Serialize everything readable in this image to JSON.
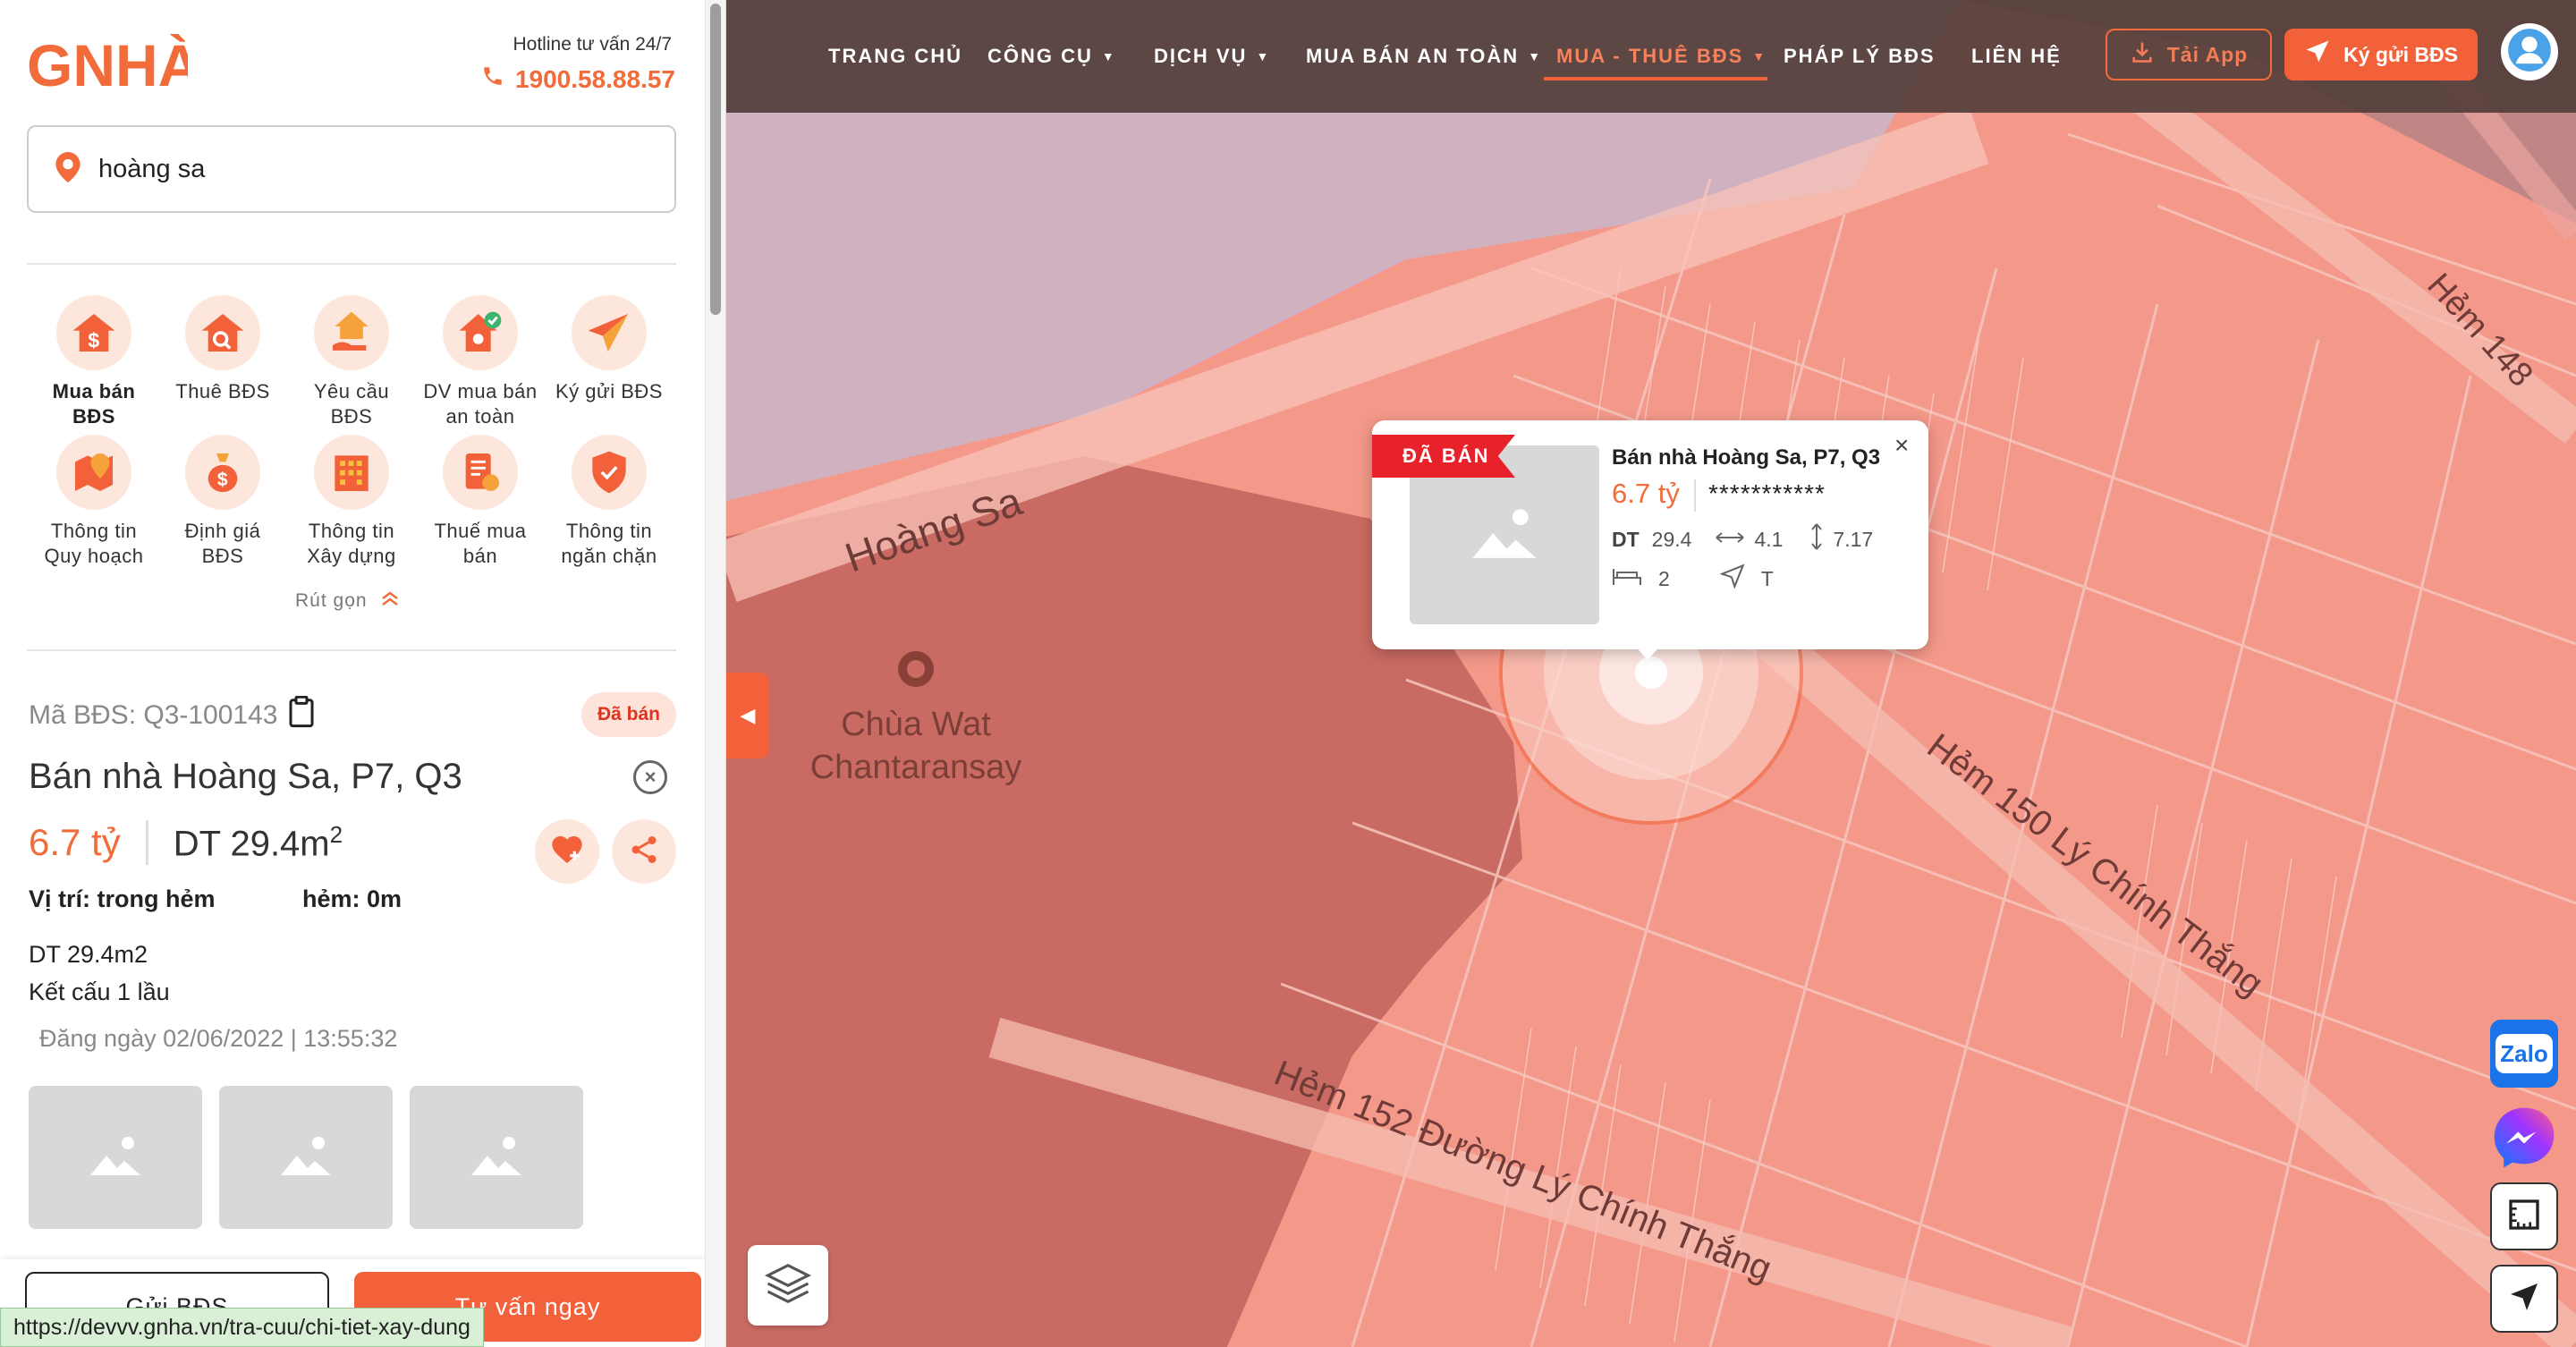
{
  "brand": {
    "logo_text": "GNHÀ"
  },
  "hotline": {
    "label": "Hotline tư vấn 24/7",
    "number": "1900.58.88.57"
  },
  "search": {
    "value": "hoàng sa"
  },
  "categories": [
    {
      "label": "Mua bán\nBĐS",
      "icon": "house-dollar-icon"
    },
    {
      "label": "Thuê BĐS",
      "icon": "house-search-icon"
    },
    {
      "label": "Yêu cầu\nBĐS",
      "icon": "house-hand-icon"
    },
    {
      "label": "DV mua bán\nan toàn",
      "icon": "house-check-icon"
    },
    {
      "label": "Ký gửi BĐS",
      "icon": "paper-plane-icon"
    },
    {
      "label": "Thông tin\nQuy hoạch",
      "icon": "map-pin-icon"
    },
    {
      "label": "Định giá\nBĐS",
      "icon": "money-bag-icon"
    },
    {
      "label": "Thông tin\nXây dựng",
      "icon": "building-icon"
    },
    {
      "label": "Thuế mua\nbán",
      "icon": "tax-document-icon"
    },
    {
      "label": "Thông tin\nngăn chặn",
      "icon": "shield-icon"
    }
  ],
  "collapse_label": "Rút gọn",
  "property": {
    "code": "Mã BĐS: Q3-100143",
    "status": "Đã bán",
    "title": "Bán nhà Hoàng Sa, P7, Q3",
    "price": "6.7 tỷ",
    "area_label": "DT 29.4m",
    "area_sup": "2",
    "location": "Vị trí: trong hẻm",
    "alley": "hẻm: 0m",
    "desc_line1": "DT 29.4m2",
    "desc_line2": "Kết cấu 1 lầu",
    "posted": "Đăng ngày 02/06/2022 | 13:55:32"
  },
  "actions": {
    "send": "Gửi BĐS",
    "advise": "Tư vấn ngay"
  },
  "status_url": "https://devvv.gnha.vn/tra-cuu/chi-tiet-xay-dung",
  "nav": {
    "items": [
      "TRANG CHỦ",
      "CÔNG CỤ",
      "DỊCH VỤ",
      "MUA BÁN AN TOÀN",
      "MUA - THUÊ BĐS",
      "PHÁP LÝ BĐS",
      "LIÊN HỆ"
    ],
    "download": "Tải App",
    "consign": "Ký gửi BĐS"
  },
  "map": {
    "streets": [
      "Hoàng Sa",
      "Hẻm 150 Lý Chính Thắng",
      "Hẻm 152 Đường Lý Chính Thắng",
      "Hẻm 148"
    ],
    "poi": [
      "Chùa Wat",
      "Chantaransay"
    ]
  },
  "popup": {
    "ribbon": "ĐÃ BÁN",
    "title": "Bán nhà Hoàng Sa, P7, Q3",
    "price": "6.7 tỷ",
    "masked": "***********",
    "dt_label": "DT",
    "dt_value": "29.4",
    "width": "4.1",
    "length": "7.17",
    "bedrooms": "2",
    "direction": "T"
  },
  "floating": {
    "zalo": "Zalo"
  },
  "colors": {
    "accent": "#f2613a",
    "sold": "#e8222a",
    "nav_bg": "#523e3a"
  }
}
